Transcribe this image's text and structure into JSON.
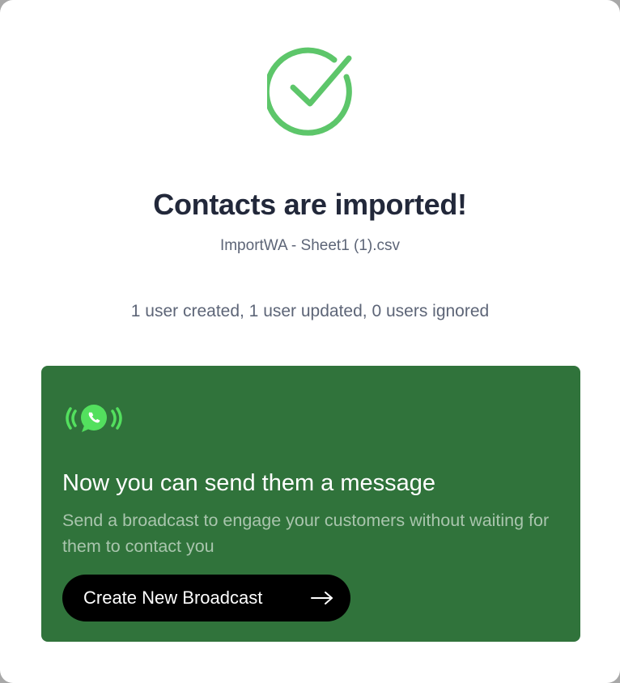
{
  "result": {
    "icon": "check-circle-icon",
    "title": "Contacts are imported!",
    "filename": "ImportWA - Sheet1 (1).csv",
    "summary": "1 user created, 1 user updated, 0 users ignored",
    "counts": {
      "created": 1,
      "updated": 1,
      "ignored": 0
    }
  },
  "promo": {
    "icon": "whatsapp-broadcast-icon",
    "title": "Now you can send them a message",
    "description": "Send a broadcast to engage your customers without waiting for them to contact you",
    "button_label": "Create New Broadcast",
    "button_icon": "arrow-right-icon"
  },
  "colors": {
    "success_green": "#5dc66a",
    "card_green": "#30733b",
    "whatsapp_green": "#53e05e",
    "button_black": "#000000"
  }
}
